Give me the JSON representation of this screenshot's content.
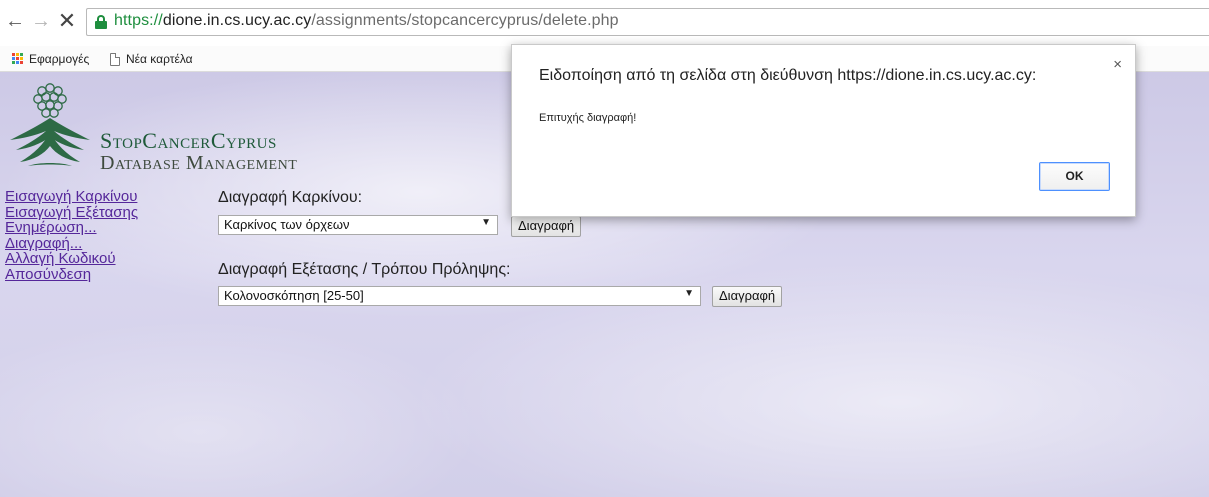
{
  "browser": {
    "url_scheme": "https://",
    "url_host": "dione.in.cs.ucy.ac.cy",
    "url_path": "/assignments/stopcancercyprus/delete.php",
    "bookmarks": [
      {
        "label": "Εφαρμογές",
        "icon": "apps-icon"
      },
      {
        "label": "Νέα καρτέλα",
        "icon": "page-icon"
      }
    ]
  },
  "site": {
    "brand_line1": "StopCancerCyprus",
    "brand_line2": "Database Management",
    "nav_links": [
      {
        "label": "Εισαγωγή Καρκίνου"
      },
      {
        "label": "Εισαγωγή Εξέτασης"
      },
      {
        "label": "Ενημέρωση..."
      },
      {
        "label": "Διαγραφή..."
      },
      {
        "label": "Αλλαγή Κωδικού"
      },
      {
        "label": "Αποσύνδεση"
      }
    ]
  },
  "delete_cancer": {
    "label": "Διαγραφή Καρκίνου:",
    "selected": "Καρκίνος των όρχεων",
    "button": "Διαγραφή"
  },
  "delete_exam": {
    "label": "Διαγραφή Εξέτασης / Τρόπου Πρόληψης:",
    "selected": "Κολονοσκόπηση [25-50]",
    "button": "Διαγραφή"
  },
  "dialog": {
    "title": "Ειδοποίηση από τη σελίδα στη διεύθυνση https://dione.in.cs.ucy.ac.cy:",
    "message": "Επιτυχής διαγραφή!",
    "ok_label": "OK",
    "close_glyph": "×"
  },
  "colors": {
    "link": "#55279a",
    "brand_green": "#1f5a3a",
    "page_background": "#d4d1ea",
    "secure_green": "#1e8e3e"
  }
}
